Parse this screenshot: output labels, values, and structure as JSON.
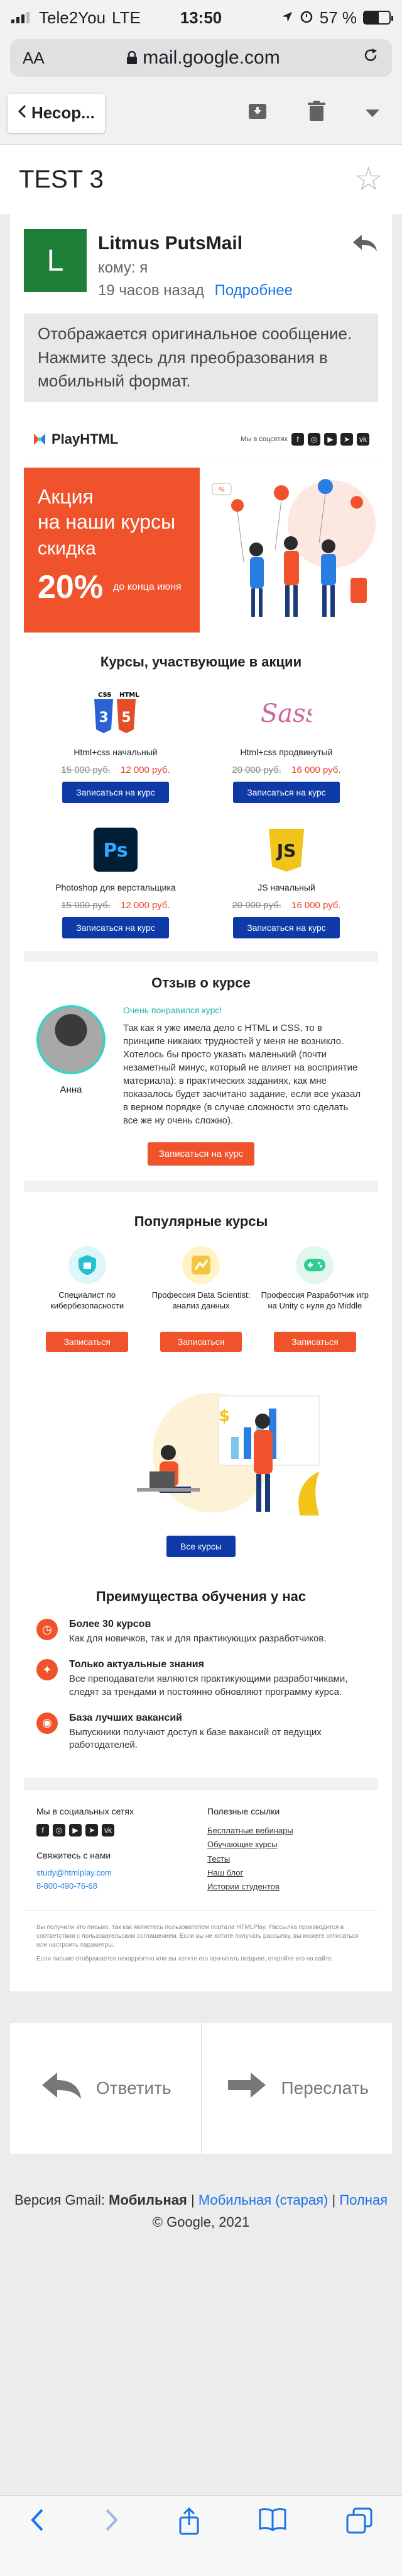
{
  "status": {
    "carrier": "Tele2You",
    "network": "LTE",
    "time": "13:50",
    "battery": "57 %",
    "battery_level": 0.57
  },
  "address": {
    "aa": "AA",
    "url": "mail.google.com"
  },
  "toolbar": {
    "back_label": "Несор...",
    "icons": [
      "archive-icon",
      "trash-icon",
      "more-caret-icon"
    ]
  },
  "message": {
    "subject": "TEST 3",
    "sender": "Litmus PutsMail",
    "avatar_letter": "L",
    "to": "кому: я",
    "time": "19 часов назад",
    "details_link": "Подробнее",
    "notice": "Отображается оригинальное сообщение. Нажмите здесь для преобразования в мобильный формат."
  },
  "email": {
    "brand": "PlayHTML",
    "social_label": "Мы в соцсетях",
    "promo": {
      "title1": "Акция",
      "title2": "на наши курсы",
      "subtitle": "скидка",
      "percent": "20%",
      "until": "до конца июня"
    },
    "courses_title": "Курсы, участвующие в акции",
    "courses": [
      {
        "name": "Html+css начальный",
        "old": "15 000 руб.",
        "new": "12 000 руб.",
        "button": "Записаться на курс",
        "logo": "html5-css3-logo"
      },
      {
        "name": "Html+css продвинутый",
        "old": "20 000 руб.",
        "new": "16 000 руб.",
        "button": "Записаться на курс",
        "logo": "sass-logo"
      },
      {
        "name": "Photoshop для верстальщика",
        "old": "15 000 руб.",
        "new": "12 000 руб.",
        "button": "Записаться на курс",
        "logo": "photoshop-logo"
      },
      {
        "name": "JS начальный",
        "old": "20 000 руб.",
        "new": "16 000 руб.",
        "button": "Записаться на курс",
        "logo": "js-logo"
      }
    ],
    "review": {
      "title": "Отзыв о курсе",
      "name": "Анна",
      "headline": "Очень понравился курс!",
      "text": "Так как я уже имела дело с HTML и CSS, то в принципе никаких трудностей у меня не возникло. Хотелось бы просто указать маленький (почти незаметный минус, который не влияет на восприятие материала): в практических заданиях, как мне показалось будет засчитано задание, если все указал в верном порядке (в случае сложности это сделать все же ну очень сложно).",
      "button": "Записаться на курс"
    },
    "popular": {
      "title": "Популярные курсы",
      "items": [
        {
          "name": "Специалист по кибербезопасности",
          "button": "Записаться",
          "icon": "shield-icon"
        },
        {
          "name": "Профессия Data Scientist: анализ данных",
          "button": "Записаться",
          "icon": "chart-icon"
        },
        {
          "name": "Профессия Разработчик игр на Unity с нуля до Middle",
          "button": "Записаться",
          "icon": "gamepad-icon"
        }
      ],
      "all_button": "Все курсы"
    },
    "advantages": {
      "title": "Преимущества обучения у нас",
      "items": [
        {
          "title": "Более 30 курсов",
          "text": "Как для новичков, так и для практикующих разработчиков."
        },
        {
          "title": "Только актуальные знания",
          "text": "Все преподаватели являются практикующими разработчиками, следят за трендами и постоянно обновляют программу курса."
        },
        {
          "title": "База лучших вакансий",
          "text": "Выпускники получают доступ к базе вакансий от ведущих работодателей."
        }
      ]
    },
    "footer": {
      "social_title": "Мы в социальных сетях",
      "contact_title": "Свяжитесь с нами",
      "email": "study@htmlplay.com",
      "phone": "8-800-490-76-68",
      "links_title": "Полезные ссылки",
      "links": [
        "Бесплатные вебинары",
        "Обучающие курсы",
        "Тесты",
        "Наш блог",
        "Истории студентов"
      ],
      "legal1": "Вы получили это письмо, так как являетесь пользователем портала HTMLPlay. Рассылка производится в соответствии с пользовательским соглашением. Если вы не хотите получать рассылку, вы можете отписаться или настроить параметры.",
      "legal2": "Если письмо отображается некорректно или вы хотите его прочитать позднее, откройте его на сайте."
    }
  },
  "actions": {
    "reply": "Ответить",
    "forward": "Переслать"
  },
  "gmail_footer": {
    "prefix": "Версия Gmail:",
    "mobile": "Мобильная",
    "old": "Мобильная (старая)",
    "full": "Полная",
    "copyright": "© Google, 2021"
  }
}
